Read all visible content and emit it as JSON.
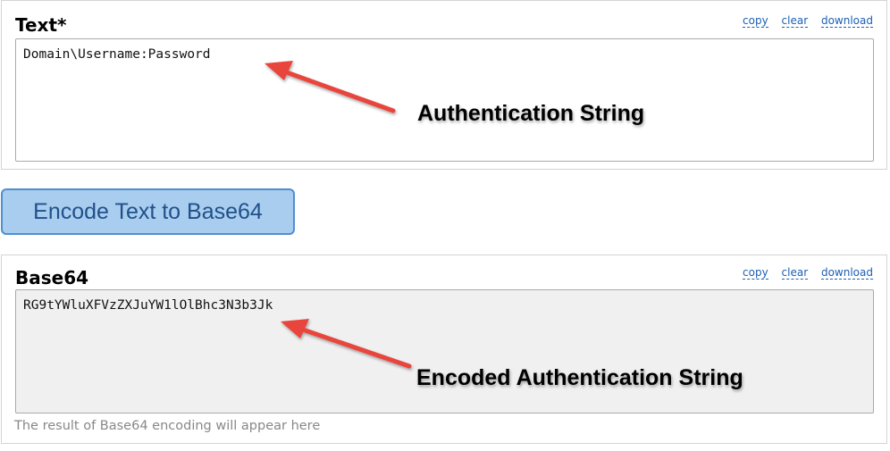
{
  "text_panel": {
    "title": "Text*",
    "links": {
      "copy": "copy",
      "clear": "clear",
      "download": "download"
    },
    "value": "Domain\\Username:Password"
  },
  "encode_button": {
    "label": "Encode Text to Base64"
  },
  "base64_panel": {
    "title": "Base64",
    "links": {
      "copy": "copy",
      "clear": "clear",
      "download": "download"
    },
    "value": "RG9tYWluXFVzZXJuYW1lOlBhc3N3b3Jk",
    "hint": "The result of Base64 encoding will appear here"
  },
  "annotations": {
    "callout_1": "Authentication String",
    "callout_2": "Encoded Authentication String",
    "arrow_color": "#e8453c"
  }
}
